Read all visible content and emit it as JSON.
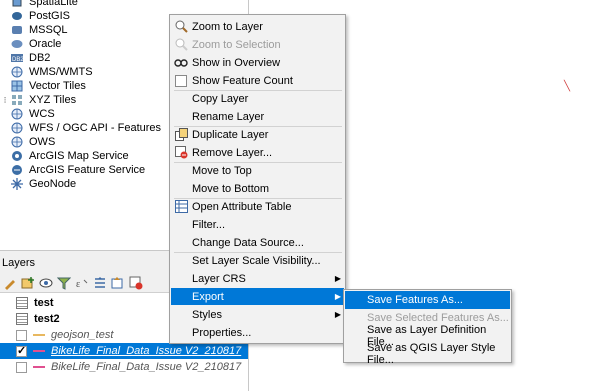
{
  "browser": {
    "items": [
      {
        "label": "SpatiaLite",
        "icon": "spatialite-icon",
        "expandable": false
      },
      {
        "label": "PostGIS",
        "icon": "postgis-icon",
        "expandable": false
      },
      {
        "label": "MSSQL",
        "icon": "mssql-icon",
        "expandable": false
      },
      {
        "label": "Oracle",
        "icon": "oracle-icon",
        "expandable": false
      },
      {
        "label": "DB2",
        "icon": "db2-icon",
        "expandable": false
      },
      {
        "label": "WMS/WMTS",
        "icon": "globe-icon",
        "expandable": false
      },
      {
        "label": "Vector Tiles",
        "icon": "vector-tiles-icon",
        "expandable": false
      },
      {
        "label": "XYZ Tiles",
        "icon": "xyz-tiles-icon",
        "expandable": true
      },
      {
        "label": "WCS",
        "icon": "globe-icon",
        "expandable": false
      },
      {
        "label": "WFS / OGC API - Features",
        "icon": "globe-icon",
        "expandable": false
      },
      {
        "label": "OWS",
        "icon": "globe-icon",
        "expandable": false
      },
      {
        "label": "ArcGIS Map Service",
        "icon": "arcgis-map-icon",
        "expandable": false
      },
      {
        "label": "ArcGIS Feature Service",
        "icon": "arcgis-feature-icon",
        "expandable": false
      },
      {
        "label": "GeoNode",
        "icon": "geonode-icon",
        "expandable": false
      }
    ]
  },
  "layers_panel": {
    "title": "Layers",
    "toolbar_icons": [
      "open-layer-styling-icon",
      "add-group-icon",
      "manage-visibility-icon",
      "filter-legend-icon",
      "filter-expression-icon",
      "expand-all-icon",
      "collapse-all-icon",
      "remove-layer-icon"
    ],
    "layers": [
      {
        "name": "test",
        "type": "table",
        "checked": false,
        "bold": true,
        "selected": false,
        "italic": false
      },
      {
        "name": "test2",
        "type": "table",
        "checked": false,
        "bold": true,
        "selected": false,
        "italic": false
      },
      {
        "name": "geojson_test",
        "type": "line",
        "checked": false,
        "bold": false,
        "selected": false,
        "italic": true,
        "color": "#e8b860"
      },
      {
        "name": "BikeLife_Final_Data_Issue V2_210817",
        "type": "line",
        "checked": true,
        "bold": false,
        "selected": true,
        "italic": true,
        "color": "#e05090"
      },
      {
        "name": "BikeLife_Final_Data_Issue V2_210817",
        "type": "line",
        "checked": false,
        "bold": false,
        "selected": false,
        "italic": true,
        "color": "#e05090"
      }
    ]
  },
  "context_menu": {
    "items": [
      {
        "label": "Zoom to Layer",
        "icon": "zoom-to-layer-icon",
        "disabled": false,
        "submenu": false,
        "active": false
      },
      {
        "label": "Zoom to Selection",
        "icon": "zoom-to-selection-icon",
        "disabled": true,
        "submenu": false,
        "active": false
      },
      {
        "label": "Show in Overview",
        "icon": "show-overview-icon",
        "disabled": false,
        "submenu": false,
        "active": false
      },
      {
        "label": "Show Feature Count",
        "icon": "checkbox-icon",
        "disabled": false,
        "submenu": false,
        "active": false
      },
      {
        "label": "Copy Layer",
        "icon": "",
        "disabled": false,
        "submenu": false,
        "active": false
      },
      {
        "label": "Rename Layer",
        "icon": "",
        "disabled": false,
        "submenu": false,
        "active": false
      },
      {
        "label": "Duplicate Layer",
        "icon": "duplicate-layer-icon",
        "disabled": false,
        "submenu": false,
        "active": false
      },
      {
        "label": "Remove Layer...",
        "icon": "remove-layer-icon",
        "disabled": false,
        "submenu": false,
        "active": false
      },
      {
        "label": "Move to Top",
        "icon": "",
        "disabled": false,
        "submenu": false,
        "active": false
      },
      {
        "label": "Move to Bottom",
        "icon": "",
        "disabled": false,
        "submenu": false,
        "active": false
      },
      {
        "label": "Open Attribute Table",
        "icon": "attribute-table-icon",
        "disabled": false,
        "submenu": false,
        "active": false
      },
      {
        "label": "Filter...",
        "icon": "",
        "disabled": false,
        "submenu": false,
        "active": false
      },
      {
        "label": "Change Data Source...",
        "icon": "",
        "disabled": false,
        "submenu": false,
        "active": false
      },
      {
        "label": "Set Layer Scale Visibility...",
        "icon": "",
        "disabled": false,
        "submenu": false,
        "active": false
      },
      {
        "label": "Layer CRS",
        "icon": "",
        "disabled": false,
        "submenu": true,
        "active": false
      },
      {
        "label": "Export",
        "icon": "",
        "disabled": false,
        "submenu": true,
        "active": true
      },
      {
        "label": "Styles",
        "icon": "",
        "disabled": false,
        "submenu": true,
        "active": false
      },
      {
        "label": "Properties...",
        "icon": "",
        "disabled": false,
        "submenu": false,
        "active": false
      }
    ]
  },
  "export_submenu": {
    "items": [
      {
        "label": "Save Features As...",
        "disabled": false,
        "active": true
      },
      {
        "label": "Save Selected Features As...",
        "disabled": true,
        "active": false
      },
      {
        "label": "Save as Layer Definition File...",
        "disabled": false,
        "active": false
      },
      {
        "label": "Save as QGIS Layer Style File...",
        "disabled": false,
        "active": false
      }
    ]
  },
  "colors": {
    "selection": "#0078d7",
    "menu_bg": "#f2f2f2",
    "disabled_text": "#9c9c9c"
  }
}
